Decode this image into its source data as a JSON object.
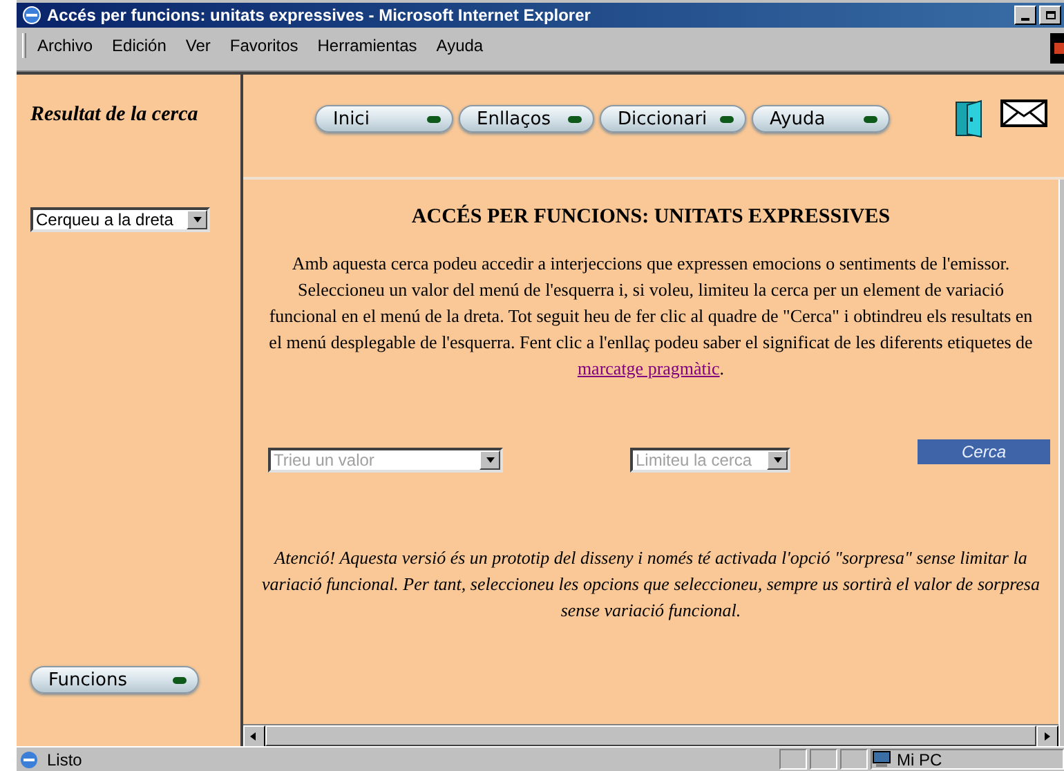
{
  "window": {
    "title": "Accés per funcions: unitats expressives - Microsoft Internet Explorer"
  },
  "menu": [
    "Archivo",
    "Edición",
    "Ver",
    "Favoritos",
    "Herramientas",
    "Ayuda"
  ],
  "left_frame": {
    "heading": "Resultat de la cerca",
    "dropdown": "Cerqueu a la dreta",
    "button": "Funcions"
  },
  "nav_buttons": [
    "Inici",
    "Enllaços",
    "Diccionari",
    "Ayuda"
  ],
  "main": {
    "title": "ACCÉS PER FUNCIONS: UNITATS EXPRESSIVES",
    "intro": "Amb aquesta cerca podeu accedir a interjeccions que expressen emocions o sentiments de l'emissor. Seleccioneu un valor del menú de l'esquerra i, si voleu, limiteu la cerca per un element de variació funcional en el menú de la dreta. Tot seguit heu de fer clic al quadre de \"Cerca\" i obtindreu els resultats en el menú desplegable de l'esquerra. Fent clic a l'enllaç podeu saber el significat de les diferents etiquetes de",
    "link": "marcatge pragmàtic",
    "intro_end": ".",
    "selects": [
      {
        "placeholder": "Trieu un valor"
      },
      {
        "placeholder": "Limiteu la cerca"
      }
    ],
    "search_button": "Cerca",
    "notice": "Atenció! Aquesta versió és un prototip del disseny i només té activada l'opció \"sorpresa\" sense limitar la variació funcional. Per tant, seleccioneu les opcions que seleccioneu, sempre us sortirà el valor de sorpresa sense variació funcional."
  },
  "status_bar": {
    "text": "Listo",
    "zone": "Mi PC"
  }
}
